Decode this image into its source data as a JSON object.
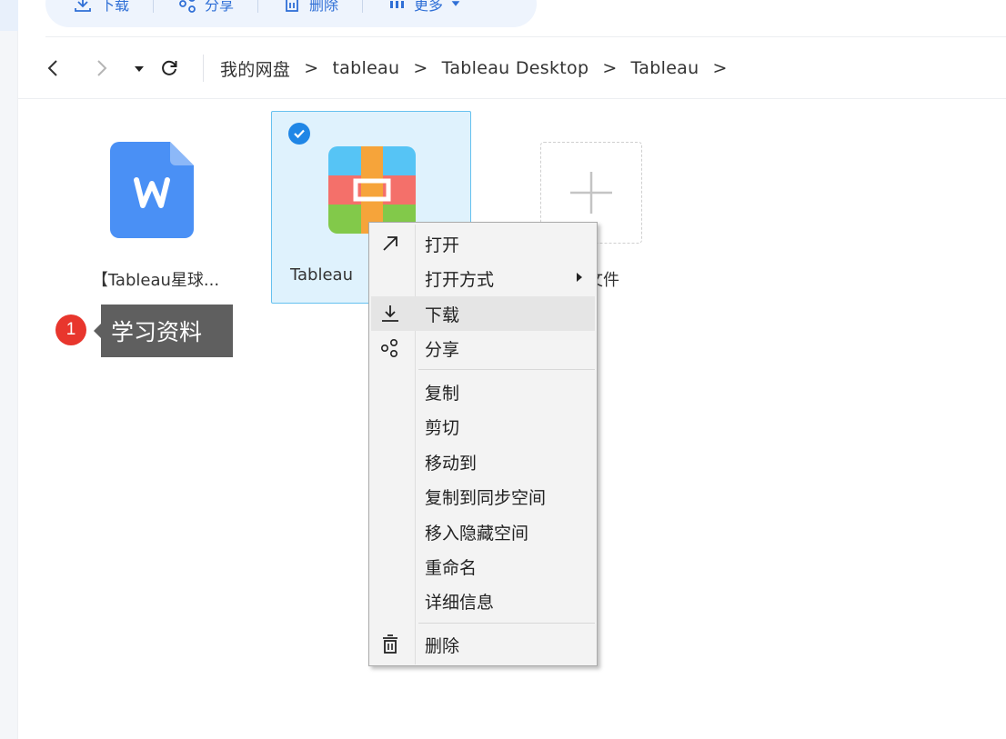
{
  "toolbar": {
    "download_label": "下载",
    "share_label": "分享",
    "delete_label": "删除",
    "more_label": "更多"
  },
  "breadcrumb": {
    "items": [
      "我的网盘",
      "tableau",
      "Tableau Desktop",
      "Tableau"
    ],
    "separator": ">"
  },
  "files": [
    {
      "name": "【Tableau星球...",
      "type": "word-document",
      "selected": false
    },
    {
      "name": "Tableau",
      "type": "archive",
      "selected": true
    },
    {
      "name": "文件",
      "type": "new-file"
    }
  ],
  "tooltip": {
    "badge": "1",
    "text": "学习资料"
  },
  "context_menu": {
    "items": [
      {
        "label": "打开",
        "icon": "open-arrow-icon"
      },
      {
        "label": "打开方式",
        "submenu": true
      },
      {
        "label": "下载",
        "icon": "download-icon",
        "hover": true
      },
      {
        "label": "分享",
        "icon": "share-icon"
      },
      {
        "label": "复制"
      },
      {
        "label": "剪切"
      },
      {
        "label": "移动到"
      },
      {
        "label": "复制到同步空间"
      },
      {
        "label": "移入隐藏空间"
      },
      {
        "label": "重命名"
      },
      {
        "label": "详细信息"
      },
      {
        "label": "删除",
        "icon": "trash-icon"
      }
    ]
  },
  "colors": {
    "accent": "#2f6fd6",
    "selection_bg": "#dff2fd",
    "selection_border": "#66c1ef",
    "badge_red": "#e8362d",
    "tooltip_bg": "#5f5f5f",
    "word_blue": "#4a90f5"
  }
}
